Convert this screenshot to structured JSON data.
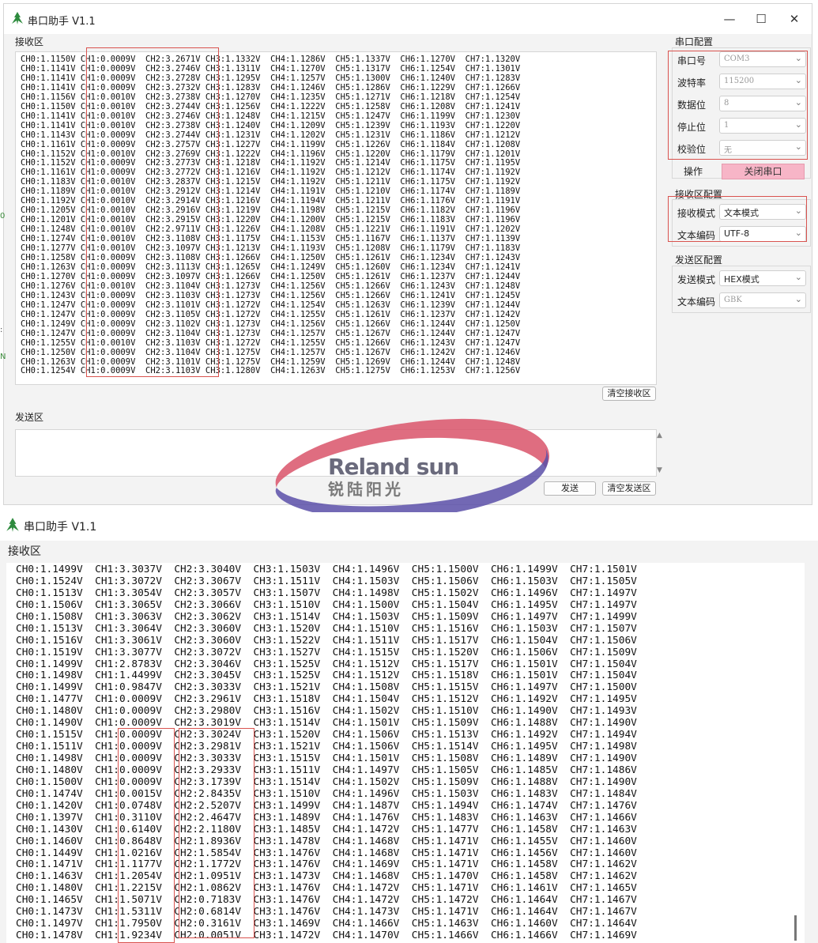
{
  "win1": {
    "title": "串口助手 V1.1",
    "controls": {
      "minimize": "—",
      "maximize": "☐",
      "close": "✕"
    },
    "rx_label": "接收区",
    "rx_lines": [
      "CH0:1.1150V CH1:0.0009V  CH2:3.2671V CH3:1.1332V  CH4:1.1286V  CH5:1.1337V  CH6:1.1270V  CH7:1.1320V",
      "CH0:1.1141V CH1:0.0009V  CH2:3.2746V CH3:1.1311V  CH4:1.1270V  CH5:1.1317V  CH6:1.1254V  CH7:1.1301V",
      "CH0:1.1141V CH1:0.0009V  CH2:3.2728V CH3:1.1295V  CH4:1.1257V  CH5:1.1300V  CH6:1.1240V  CH7:1.1283V",
      "CH0:1.1141V CH1:0.0009V  CH2:3.2732V CH3:1.1283V  CH4:1.1246V  CH5:1.1286V  CH6:1.1229V  CH7:1.1266V",
      "CH0:1.1156V CH1:0.0010V  CH2:3.2738V CH3:1.1270V  CH4:1.1235V  CH5:1.1271V  CH6:1.1218V  CH7:1.1254V",
      "CH0:1.1150V CH1:0.0010V  CH2:3.2744V CH3:1.1256V  CH4:1.1222V  CH5:1.1258V  CH6:1.1208V  CH7:1.1241V",
      "CH0:1.1141V CH1:0.0010V  CH2:3.2746V CH3:1.1248V  CH4:1.1215V  CH5:1.1247V  CH6:1.1199V  CH7:1.1230V",
      "CH0:1.1141V CH1:0.0010V  CH2:3.2738V CH3:1.1240V  CH4:1.1209V  CH5:1.1239V  CH6:1.1193V  CH7:1.1220V",
      "CH0:1.1143V CH1:0.0009V  CH2:3.2744V CH3:1.1231V  CH4:1.1202V  CH5:1.1231V  CH6:1.1186V  CH7:1.1212V",
      "CH0:1.1161V CH1:0.0009V  CH2:3.2757V CH3:1.1227V  CH4:1.1199V  CH5:1.1226V  CH6:1.1184V  CH7:1.1208V",
      "CH0:1.1152V CH1:0.0010V  CH2:3.2769V CH3:1.1222V  CH4:1.1196V  CH5:1.1220V  CH6:1.1179V  CH7:1.1201V",
      "CH0:1.1152V CH1:0.0009V  CH2:3.2773V CH3:1.1218V  CH4:1.1192V  CH5:1.1214V  CH6:1.1175V  CH7:1.1195V",
      "CH0:1.1161V CH1:0.0009V  CH2:3.2772V CH3:1.1216V  CH4:1.1192V  CH5:1.1212V  CH6:1.1174V  CH7:1.1192V",
      "CH0:1.1183V CH1:0.0010V  CH2:3.2837V CH3:1.1215V  CH4:1.1192V  CH5:1.1211V  CH6:1.1175V  CH7:1.1192V",
      "CH0:1.1189V CH1:0.0010V  CH2:3.2912V CH3:1.1214V  CH4:1.1191V  CH5:1.1210V  CH6:1.1174V  CH7:1.1189V",
      "CH0:1.1192V CH1:0.0010V  CH2:3.2914V CH3:1.1216V  CH4:1.1194V  CH5:1.1211V  CH6:1.1176V  CH7:1.1191V",
      "CH0:1.1205V CH1:0.0010V  CH2:3.2916V CH3:1.1219V  CH4:1.1198V  CH5:1.1215V  CH6:1.1182V  CH7:1.1196V",
      "CH0:1.1201V CH1:0.0010V  CH2:3.2915V CH3:1.1220V  CH4:1.1200V  CH5:1.1215V  CH6:1.1183V  CH7:1.1196V",
      "CH0:1.1248V CH1:0.0010V  CH2:2.9711V CH3:1.1226V  CH4:1.1208V  CH5:1.1221V  CH6:1.1191V  CH7:1.1202V",
      "CH0:1.1274V CH1:0.0010V  CH2:3.1108V CH3:1.1175V  CH4:1.1153V  CH5:1.1167V  CH6:1.1137V  CH7:1.1139V",
      "CH0:1.1277V CH1:0.0010V  CH2:3.1097V CH3:1.1213V  CH4:1.1193V  CH5:1.1208V  CH6:1.1179V  CH7:1.1183V",
      "CH0:1.1258V CH1:0.0009V  CH2:3.1108V CH3:1.1266V  CH4:1.1250V  CH5:1.1261V  CH6:1.1234V  CH7:1.1243V",
      "CH0:1.1263V CH1:0.0009V  CH2:3.1113V CH3:1.1265V  CH4:1.1249V  CH5:1.1260V  CH6:1.1234V  CH7:1.1241V",
      "CH0:1.1270V CH1:0.0009V  CH2:3.1097V CH3:1.1266V  CH4:1.1250V  CH5:1.1261V  CH6:1.1237V  CH7:1.1244V",
      "CH0:1.1276V CH1:0.0010V  CH2:3.1104V CH3:1.1273V  CH4:1.1256V  CH5:1.1266V  CH6:1.1243V  CH7:1.1248V",
      "CH0:1.1243V CH1:0.0009V  CH2:3.1103V CH3:1.1273V  CH4:1.1256V  CH5:1.1266V  CH6:1.1241V  CH7:1.1245V",
      "CH0:1.1247V CH1:0.0009V  CH2:3.1101V CH3:1.1272V  CH4:1.1254V  CH5:1.1263V  CH6:1.1239V  CH7:1.1244V",
      "CH0:1.1247V CH1:0.0009V  CH2:3.1105V CH3:1.1272V  CH4:1.1255V  CH5:1.1261V  CH6:1.1237V  CH7:1.1242V",
      "CH0:1.1249V CH1:0.0009V  CH2:3.1102V CH3:1.1273V  CH4:1.1256V  CH5:1.1266V  CH6:1.1244V  CH7:1.1250V",
      "CH0:1.1247V CH1:0.0009V  CH2:3.1104V CH3:1.1273V  CH4:1.1257V  CH5:1.1267V  CH6:1.1244V  CH7:1.1247V",
      "CH0:1.1255V CH1:0.0010V  CH2:3.1103V CH3:1.1272V  CH4:1.1255V  CH5:1.1266V  CH6:1.1243V  CH7:1.1247V",
      "CH0:1.1250V CH1:0.0009V  CH2:3.1104V CH3:1.1275V  CH4:1.1257V  CH5:1.1267V  CH6:1.1242V  CH7:1.1246V",
      "CH0:1.1263V CH1:0.0009V  CH2:3.1101V CH3:1.1275V  CH4:1.1259V  CH5:1.1269V  CH6:1.1244V  CH7:1.1248V",
      "CH0:1.1254V CH1:0.0009V  CH2:3.1103V CH3:1.1280V  CH4:1.1263V  CH5:1.1275V  CH6:1.1253V  CH7:1.1256V"
    ],
    "clear_rx": "清空接收区",
    "tx_label": "发送区",
    "send": "发送",
    "clear_tx": "清空发送区",
    "edge_marks": [
      "0",
      ":",
      "N"
    ],
    "serial": {
      "group": "串口配置",
      "port_label": "串口号",
      "port": "COM3",
      "baud_label": "波特率",
      "baud": "115200",
      "data_label": "数据位",
      "data": "8",
      "stop_label": "停止位",
      "stop": "1",
      "parity_label": "校验位",
      "parity": "无",
      "op_label": "操作",
      "op_button": "关闭串口"
    },
    "rxcfg": {
      "group": "接收区配置",
      "mode_label": "接收模式",
      "mode": "文本模式",
      "enc_label": "文本编码",
      "enc": "UTF-8"
    },
    "txcfg": {
      "group": "发送区配置",
      "mode_label": "发送模式",
      "mode": "HEX模式",
      "enc_label": "文本编码",
      "enc": "GBK"
    }
  },
  "watermark": {
    "line1": "Reland sun",
    "line2": "锐陆阳光"
  },
  "win2": {
    "title": "串口助手 V1.1",
    "rx_label": "接收区",
    "rx_lines": [
      "CH0:1.1499V  CH1:3.3037V  CH2:3.3040V  CH3:1.1503V  CH4:1.1496V  CH5:1.1500V  CH6:1.1499V  CH7:1.1501V",
      "CH0:1.1524V  CH1:3.3072V  CH2:3.3067V  CH3:1.1511V  CH4:1.1503V  CH5:1.1506V  CH6:1.1503V  CH7:1.1505V",
      "CH0:1.1513V  CH1:3.3054V  CH2:3.3057V  CH3:1.1507V  CH4:1.1498V  CH5:1.1502V  CH6:1.1496V  CH7:1.1497V",
      "CH0:1.1506V  CH1:3.3065V  CH2:3.3066V  CH3:1.1510V  CH4:1.1500V  CH5:1.1504V  CH6:1.1495V  CH7:1.1497V",
      "CH0:1.1508V  CH1:3.3063V  CH2:3.3062V  CH3:1.1514V  CH4:1.1503V  CH5:1.1509V  CH6:1.1497V  CH7:1.1499V",
      "CH0:1.1513V  CH1:3.3064V  CH2:3.3060V  CH3:1.1520V  CH4:1.1510V  CH5:1.1516V  CH6:1.1503V  CH7:1.1507V",
      "CH0:1.1516V  CH1:3.3061V  CH2:3.3060V  CH3:1.1522V  CH4:1.1511V  CH5:1.1517V  CH6:1.1504V  CH7:1.1506V",
      "CH0:1.1519V  CH1:3.3077V  CH2:3.3072V  CH3:1.1527V  CH4:1.1515V  CH5:1.1520V  CH6:1.1506V  CH7:1.1509V",
      "CH0:1.1499V  CH1:2.8783V  CH2:3.3046V  CH3:1.1525V  CH4:1.1512V  CH5:1.1517V  CH6:1.1501V  CH7:1.1504V",
      "CH0:1.1498V  CH1:1.4499V  CH2:3.3045V  CH3:1.1525V  CH4:1.1512V  CH5:1.1518V  CH6:1.1501V  CH7:1.1504V",
      "CH0:1.1499V  CH1:0.9847V  CH2:3.3033V  CH3:1.1521V  CH4:1.1508V  CH5:1.1515V  CH6:1.1497V  CH7:1.1500V",
      "CH0:1.1477V  CH1:0.0009V  CH2:3.2961V  CH3:1.1518V  CH4:1.1504V  CH5:1.1512V  CH6:1.1492V  CH7:1.1495V",
      "CH0:1.1480V  CH1:0.0009V  CH2:3.2980V  CH3:1.1516V  CH4:1.1502V  CH5:1.1510V  CH6:1.1490V  CH7:1.1493V",
      "CH0:1.1490V  CH1:0.0009V  CH2:3.3019V  CH3:1.1514V  CH4:1.1501V  CH5:1.1509V  CH6:1.1488V  CH7:1.1490V",
      "CH0:1.1515V  CH1:0.0009V  CH2:3.3024V  CH3:1.1520V  CH4:1.1506V  CH5:1.1513V  CH6:1.1492V  CH7:1.1494V",
      "CH0:1.1511V  CH1:0.0009V  CH2:3.2981V  CH3:1.1521V  CH4:1.1506V  CH5:1.1514V  CH6:1.1495V  CH7:1.1498V",
      "CH0:1.1498V  CH1:0.0009V  CH2:3.3033V  CH3:1.1515V  CH4:1.1501V  CH5:1.1508V  CH6:1.1489V  CH7:1.1490V",
      "CH0:1.1480V  CH1:0.0009V  CH2:3.2933V  CH3:1.1511V  CH4:1.1497V  CH5:1.1505V  CH6:1.1485V  CH7:1.1486V",
      "CH0:1.1500V  CH1:0.0009V  CH2:3.1739V  CH3:1.1514V  CH4:1.1502V  CH5:1.1509V  CH6:1.1488V  CH7:1.1490V",
      "CH0:1.1474V  CH1:0.0015V  CH2:2.8435V  CH3:1.1510V  CH4:1.1496V  CH5:1.1503V  CH6:1.1483V  CH7:1.1484V",
      "CH0:1.1420V  CH1:0.0748V  CH2:2.5207V  CH3:1.1499V  CH4:1.1487V  CH5:1.1494V  CH6:1.1474V  CH7:1.1476V",
      "CH0:1.1397V  CH1:0.3110V  CH2:2.4647V  CH3:1.1489V  CH4:1.1476V  CH5:1.1483V  CH6:1.1463V  CH7:1.1466V",
      "CH0:1.1430V  CH1:0.6140V  CH2:2.1180V  CH3:1.1485V  CH4:1.1472V  CH5:1.1477V  CH6:1.1458V  CH7:1.1463V",
      "CH0:1.1460V  CH1:0.8648V  CH2:1.8936V  CH3:1.1478V  CH4:1.1468V  CH5:1.1471V  CH6:1.1455V  CH7:1.1460V",
      "CH0:1.1449V  CH1:1.0216V  CH2:1.5854V  CH3:1.1476V  CH4:1.1468V  CH5:1.1471V  CH6:1.1456V  CH7:1.1460V",
      "CH0:1.1471V  CH1:1.1177V  CH2:1.1772V  CH3:1.1476V  CH4:1.1469V  CH5:1.1471V  CH6:1.1458V  CH7:1.1462V",
      "CH0:1.1463V  CH1:1.2054V  CH2:1.0951V  CH3:1.1473V  CH4:1.1468V  CH5:1.1470V  CH6:1.1458V  CH7:1.1462V",
      "CH0:1.1480V  CH1:1.2215V  CH2:1.0862V  CH3:1.1476V  CH4:1.1472V  CH5:1.1471V  CH6:1.1461V  CH7:1.1465V",
      "CH0:1.1465V  CH1:1.5071V  CH2:0.7183V  CH3:1.1476V  CH4:1.1472V  CH5:1.1472V  CH6:1.1464V  CH7:1.1467V",
      "CH0:1.1473V  CH1:1.5311V  CH2:0.6814V  CH3:1.1476V  CH4:1.1473V  CH5:1.1471V  CH6:1.1464V  CH7:1.1467V",
      "CH0:1.1497V  CH1:1.7950V  CH2:0.3161V  CH3:1.1469V  CH4:1.1466V  CH5:1.1463V  CH6:1.1460V  CH7:1.1464V",
      "CH0:1.1478V  CH1:1.9234V  CH2:0.0051V  CH3:1.1472V  CH4:1.1470V  CH5:1.1466V  CH6:1.1466V  CH7:1.1469V"
    ]
  },
  "colors": {
    "highlight": "#d9534f",
    "close_button": "#f7b5c7",
    "watermark_red": "#d9546a",
    "watermark_blue": "#5a4fa8"
  },
  "icons": [
    "app-logo-icon",
    "minimize-icon",
    "maximize-icon",
    "close-icon",
    "chevron-down-icon",
    "scroll-up-icon",
    "scroll-down-icon"
  ]
}
